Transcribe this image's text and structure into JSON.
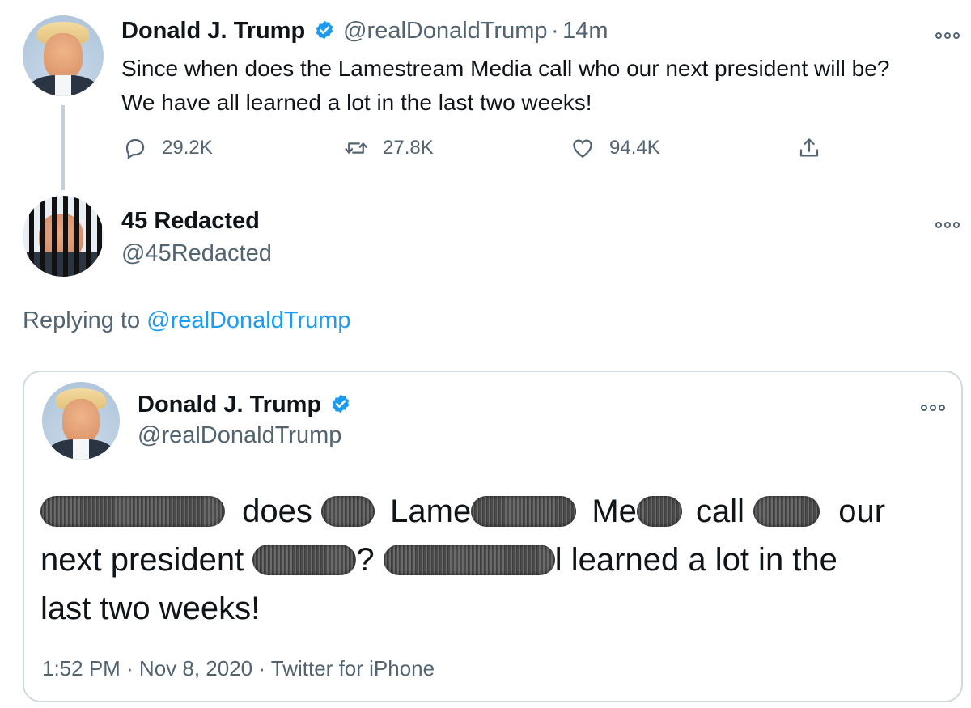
{
  "tweet": {
    "author_name": "Donald J. Trump",
    "author_handle": "@realDonaldTrump",
    "time_sep": "·",
    "time": "14m",
    "text_line1": "Since when does the Lamestream Media call who our next president will be?",
    "text_line2": "We have all learned a lot in the last two weeks!",
    "reply_count": "29.2K",
    "retweet_count": "27.8K",
    "like_count": "94.4K",
    "icons": [
      "reply-icon",
      "retweet-icon",
      "like-icon",
      "share-icon",
      "verified-badge-icon",
      "more-icon"
    ]
  },
  "reply": {
    "author_name": "45 Redacted",
    "author_handle": "@45Redacted",
    "replying_to_label": "Replying to",
    "replying_to_handle": "@realDonaldTrump"
  },
  "quote": {
    "author_name": "Donald J. Trump",
    "author_handle": "@realDonaldTrump",
    "text_parts": {
      "w_does": "does",
      "w_lame": "Lame",
      "w_me": "Me",
      "w_call": "call",
      "w_our": "our",
      "w_next_president": "next president",
      "w_q": "?",
      "w_learned": "l learned a lot in the",
      "w_last": "last two weeks!"
    },
    "timestamp": "1:52 PM · Nov 8, 2020 · Twitter for iPhone"
  },
  "colors": {
    "accent": "#1d9bf0",
    "secondary_text": "#536471",
    "border": "#cfd9de"
  }
}
